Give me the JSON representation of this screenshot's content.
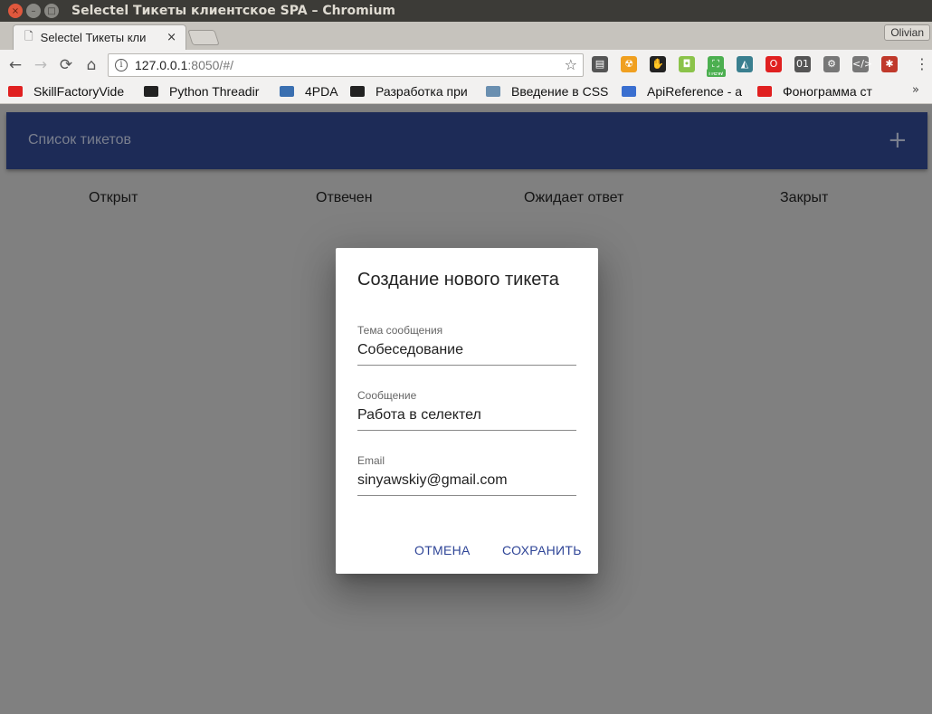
{
  "window": {
    "title": "Selectel Тикеты клиентское SPA – Chromium",
    "profile": "Olivian"
  },
  "tab": {
    "title": "Selectel Тикеты кли",
    "close": "×"
  },
  "toolbar": {
    "back": "←",
    "forward": "→",
    "reload": "⟳",
    "home": "⌂",
    "url_host": "127.0.0.1",
    "url_rest": ":8050/#/",
    "info": "i",
    "star": "☆",
    "menu": "⋮",
    "extensions": [
      {
        "name": "radio-extension-icon",
        "glyph": "▤",
        "color": "#555555"
      },
      {
        "name": "extension-orange-icon",
        "glyph": "☢",
        "color": "#f0a020"
      },
      {
        "name": "gnome-extension-icon",
        "glyph": "✋",
        "color": "#222222"
      },
      {
        "name": "extension-green-icon",
        "glyph": "◘",
        "color": "#8bc34a"
      },
      {
        "name": "screenshot-new-extension-icon",
        "glyph": "⛶",
        "color": "#4caf50"
      },
      {
        "name": "extension-teal-icon",
        "glyph": "◭",
        "color": "#3a7f8f"
      },
      {
        "name": "opera-extension-icon",
        "glyph": "O",
        "color": "#e02020"
      },
      {
        "name": "binary-extension-icon",
        "glyph": "01",
        "color": "#555555"
      },
      {
        "name": "gear-extension-icon",
        "glyph": "⚙",
        "color": "#777777"
      },
      {
        "name": "code-extension-icon",
        "glyph": "</>",
        "color": "#777777"
      },
      {
        "name": "extension-red-icon",
        "glyph": "✱",
        "color": "#c0392b"
      }
    ],
    "new_badge": "new"
  },
  "bookmarks": [
    {
      "label": "SkillFactoryVide",
      "icon": "youtube-icon",
      "color": "#e02020"
    },
    {
      "label": "Python Threadir",
      "icon": "python-icon",
      "color": "#222222"
    },
    {
      "label": "4PDA",
      "icon": "4pda-icon",
      "color": "#3a6fb0"
    },
    {
      "label": "Разработка при",
      "icon": "qr-icon",
      "color": "#222222"
    },
    {
      "label": "Введение в CSS",
      "icon": "h-icon",
      "color": "#6a8fb0"
    },
    {
      "label": "ApiReference - a",
      "icon": "home-icon",
      "color": "#3a6fd0"
    },
    {
      "label": "Фонограмма ст",
      "icon": "youtube-icon",
      "color": "#e02020"
    }
  ],
  "bookmarks_more": "»",
  "appbar": {
    "title": "Список тикетов",
    "add": "+"
  },
  "statuses": [
    "Открыт",
    "Отвечен",
    "Ожидает ответ",
    "Закрыт"
  ],
  "dialog": {
    "title": "Создание нового тикета",
    "fields": [
      {
        "label": "Тема сообщения",
        "value": "Собеседование"
      },
      {
        "label": "Сообщение",
        "value": "Работа в селектел"
      },
      {
        "label": "Email",
        "value": "sinyawskiy@gmail.com"
      }
    ],
    "cancel": "ОТМЕНА",
    "save": "СОХРАНИТЬ"
  }
}
